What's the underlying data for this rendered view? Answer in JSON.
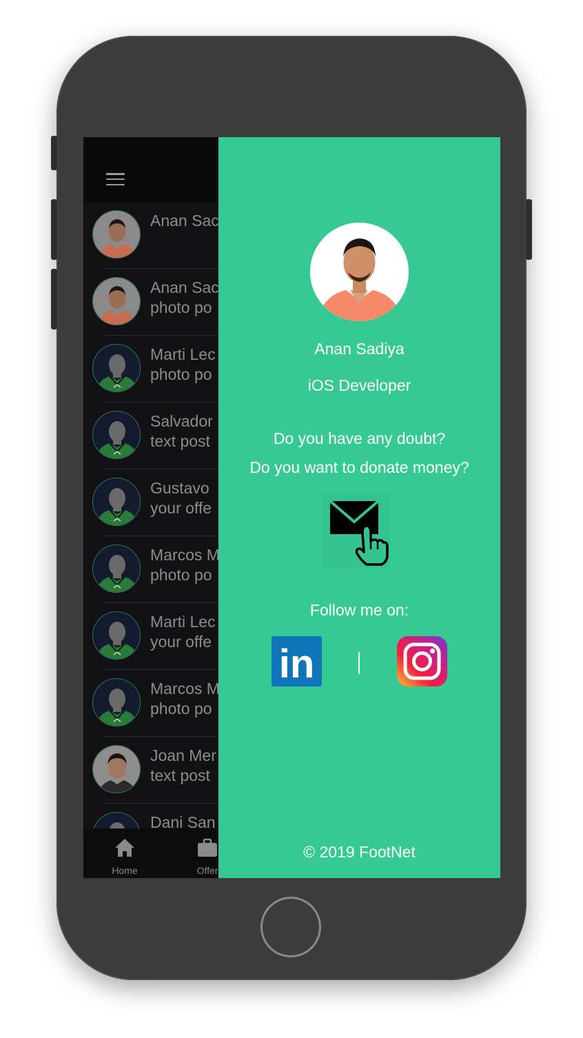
{
  "app": {
    "nav": {
      "menu_icon": "hamburger-icon"
    },
    "list": [
      {
        "name": "Anan Sac",
        "sub": "",
        "avatar": "person-orange"
      },
      {
        "name": "Anan Sac",
        "sub": "photo po",
        "avatar": "person-orange"
      },
      {
        "name": "Marti Lec",
        "sub": "photo po",
        "avatar": "silhouette"
      },
      {
        "name": "Salvador",
        "sub": "text post",
        "avatar": "silhouette"
      },
      {
        "name": "Gustavo",
        "sub": "your offe",
        "avatar": "silhouette"
      },
      {
        "name": "Marcos M",
        "sub": "photo po",
        "avatar": "silhouette"
      },
      {
        "name": "Marti Lec",
        "sub": "your offe",
        "avatar": "silhouette"
      },
      {
        "name": "Marcos M",
        "sub": "photo po",
        "avatar": "silhouette"
      },
      {
        "name": "Joan Mer",
        "sub": "text post",
        "avatar": "person-dark"
      },
      {
        "name": "Dani San",
        "sub": "",
        "avatar": "silhouette"
      }
    ],
    "tabs": [
      {
        "label": "Home",
        "icon": "home-icon"
      },
      {
        "label": "Offer",
        "icon": "briefcase-icon"
      }
    ]
  },
  "drawer": {
    "name": "Anan Sadiya",
    "role": "iOS Developer",
    "question1": "Do you have any doubt?",
    "question2": "Do you want to donate money?",
    "mail_icon": "mail-tap-icon",
    "follow_label": "Follow me on:",
    "social": [
      {
        "name": "LinkedIn",
        "icon": "linkedin-icon"
      },
      {
        "name": "Instagram",
        "icon": "instagram-icon"
      }
    ],
    "linkedin_text": "in",
    "copyright": "© 2019 FootNet"
  },
  "colors": {
    "drawer_bg": "#36c994",
    "app_bg": "#121215",
    "text_dim": "#8c8c8c",
    "linkedin_blue": "#0e76b8"
  }
}
